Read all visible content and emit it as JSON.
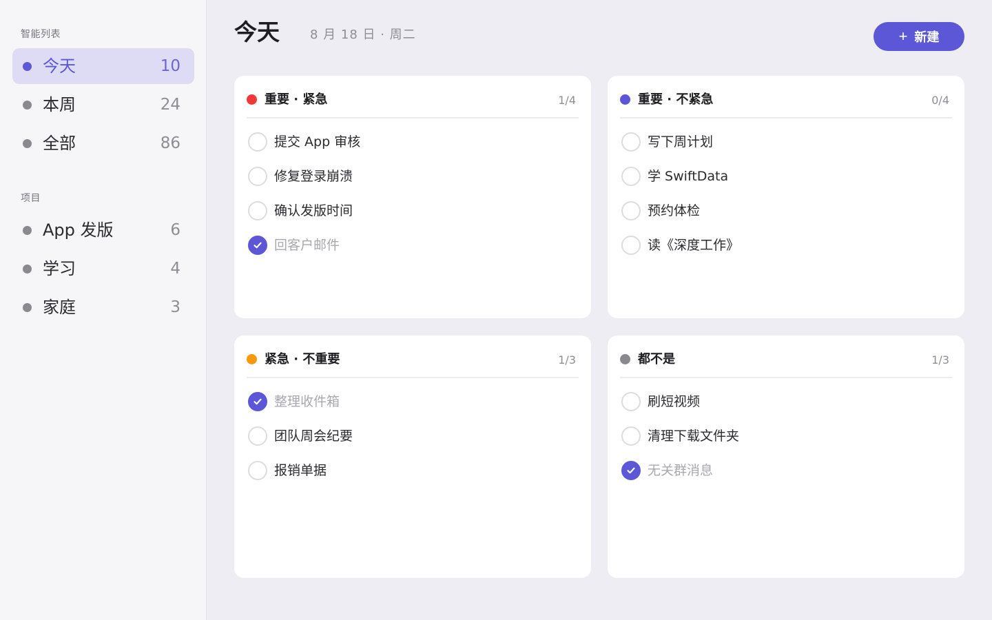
{
  "sidebar": {
    "smart_title": "智能列表",
    "smart_items": [
      {
        "label": "今天",
        "count": "10",
        "active": true
      },
      {
        "label": "本周",
        "count": "24",
        "active": false
      },
      {
        "label": "全部",
        "count": "86",
        "active": false
      }
    ],
    "project_title": "项目",
    "project_items": [
      {
        "label": "App 发版",
        "count": "6"
      },
      {
        "label": "学习",
        "count": "4"
      },
      {
        "label": "家庭",
        "count": "3"
      }
    ]
  },
  "header": {
    "title": "今天",
    "date": "8 月 18 日 · 周二",
    "new_button": "新建",
    "new_icon": "+"
  },
  "quadrants": [
    {
      "title": "重要 · 紧急",
      "progress": "1/4",
      "color": "#f03a3a",
      "tasks": [
        {
          "label": "提交 App 审核",
          "done": false
        },
        {
          "label": "修复登录崩溃",
          "done": false
        },
        {
          "label": "确认发版时间",
          "done": false
        },
        {
          "label": "回客户邮件",
          "done": true
        }
      ]
    },
    {
      "title": "重要 · 不紧急",
      "progress": "0/4",
      "color": "#5b57d6",
      "tasks": [
        {
          "label": "写下周计划",
          "done": false
        },
        {
          "label": "学 SwiftData",
          "done": false
        },
        {
          "label": "预约体检",
          "done": false
        },
        {
          "label": "读《深度工作》",
          "done": false
        }
      ]
    },
    {
      "title": "紧急 · 不重要",
      "progress": "1/3",
      "color": "#f59a0c",
      "tasks": [
        {
          "label": "整理收件箱",
          "done": true
        },
        {
          "label": "团队周会纪要",
          "done": false
        },
        {
          "label": "报销单据",
          "done": false
        }
      ]
    },
    {
      "title": "都不是",
      "progress": "1/3",
      "color": "#8a8990",
      "tasks": [
        {
          "label": "刷短视频",
          "done": false
        },
        {
          "label": "清理下载文件夹",
          "done": false
        },
        {
          "label": "无关群消息",
          "done": true
        }
      ]
    }
  ]
}
